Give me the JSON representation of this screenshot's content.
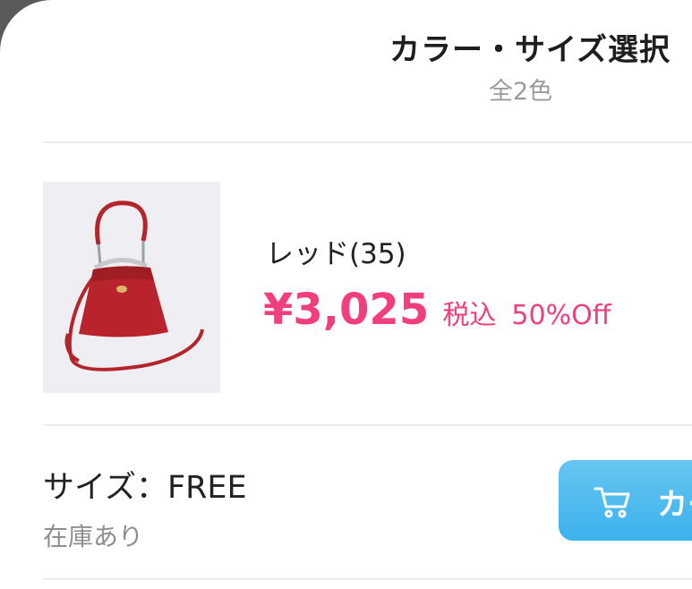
{
  "header": {
    "title": "カラー・サイズ選択",
    "subtitle": "全2色"
  },
  "item": {
    "color_name": "レッド(35)",
    "price": "¥3,025",
    "tax_label": "税込",
    "discount": "50%Off"
  },
  "size": {
    "label": "サイズ：FREE",
    "stock": "在庫あり"
  },
  "cart_button": {
    "label": "カート",
    "icon": "cart-icon"
  },
  "colors": {
    "accent_price": "#f03e7e",
    "button": "#48b8ee"
  }
}
